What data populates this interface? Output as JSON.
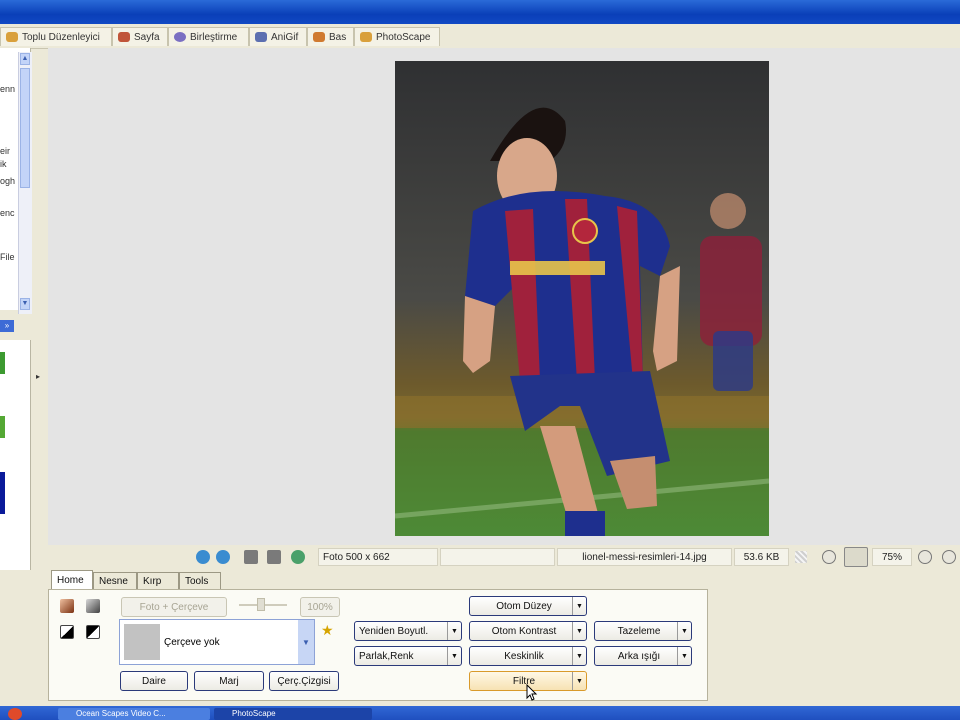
{
  "tabs": [
    {
      "label": "Toplu Düzenleyici",
      "icon": "batch-editor-icon",
      "color": "#d9a03c"
    },
    {
      "label": "Sayfa",
      "icon": "page-icon",
      "color": "#c0553a"
    },
    {
      "label": "Birleştirme",
      "icon": "combine-icon",
      "color": "#7a6fc2"
    },
    {
      "label": "AniGif",
      "icon": "anigif-icon",
      "color": "#5c6fb0"
    },
    {
      "label": "Bas",
      "icon": "print-icon",
      "color": "#d07a30"
    },
    {
      "label": "PhotoScape",
      "icon": "photoscape-icon",
      "color": "#d9a03c"
    }
  ],
  "left_panel": {
    "fragments": [
      "enn",
      "eir",
      "ik",
      "ogh",
      "enc",
      "File"
    ]
  },
  "status_bar": {
    "photo_size": "Foto 500 x 662",
    "file_name": "lionel-messi-resimleri-14.jpg",
    "file_size": "53.6 KB",
    "zoom": "75%"
  },
  "panel_tabs": [
    {
      "label": "Home",
      "active": true
    },
    {
      "label": "Nesne",
      "active": false
    },
    {
      "label": "Kırp",
      "active": false
    },
    {
      "label": "Tools",
      "active": false
    }
  ],
  "home": {
    "photo_frame_button": "Foto + Çerçeve",
    "frame_percent": "100%",
    "frame_select": "Çerçeve yok",
    "circle_button": "Daire",
    "margin_button": "Marj",
    "frame_line_button": "Çerç.Çizgisi",
    "resize": "Yeniden Boyutl.",
    "bright_color": "Parlak,Renk",
    "auto_level": "Otom Düzey",
    "auto_contrast": "Otom Kontrast",
    "sharpen": "Keskinlik",
    "filter": "Filtre",
    "refresh": "Tazeleme",
    "backlight": "Arka ışığı"
  },
  "taskbar": {
    "items": [
      "Ocean Scapes Video C...",
      "PhotoScape"
    ]
  },
  "colors": {
    "title_blue": "#0a3fb8",
    "canvas_gray": "#e4e4e4",
    "panel_beige": "#ece9d8",
    "button_border": "#2b3a7a"
  }
}
